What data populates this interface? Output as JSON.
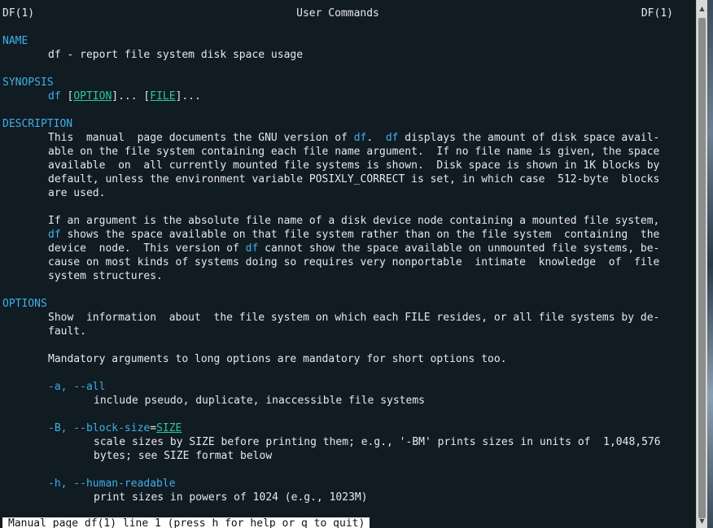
{
  "header": {
    "left": "DF(1)",
    "center": "User Commands",
    "right": "DF(1)"
  },
  "sections": {
    "name": "NAME",
    "synopsis": "SYNOPSIS",
    "description": "DESCRIPTION",
    "options": "OPTIONS"
  },
  "name_line": "df - report file system disk space usage",
  "synopsis": {
    "cmd": "df",
    "open1": " [",
    "arg1": "OPTION",
    "close1": "]... [",
    "arg2": "FILE",
    "close2": "]..."
  },
  "description": {
    "p1": {
      "l1a": "This  manual  page documents the GNU version of ",
      "l1b": "df",
      "l1c": ".  ",
      "l1d": "df",
      "l1e": " displays the amount of disk space avail-",
      "l2": "able on the file system containing each file name argument.  If no file name is given, the space",
      "l3": "available  on  all currently mounted file systems is shown.  Disk space is shown in 1K blocks by",
      "l4": "default, unless the environment variable POSIXLY_CORRECT is set, in which case  512-byte  blocks",
      "l5": "are used."
    },
    "p2": {
      "l1": "If an argument is the absolute file name of a disk device node containing a mounted file system,",
      "l2a": "df",
      "l2b": " shows the space available on that file system rather than on the file system  containing  the",
      "l3a": "device  node.  This version of ",
      "l3b": "df",
      "l3c": " cannot show the space available on unmounted file systems, be-",
      "l4": "cause on most kinds of systems doing so requires very nonportable  intimate  knowledge  of  file",
      "l5": "system structures."
    }
  },
  "options": {
    "intro1": "Show  information  about  the file system on which each FILE resides, or all file systems by de-",
    "intro2": "fault.",
    "mandatory": "Mandatory arguments to long options are mandatory for short options too.",
    "all": {
      "flag": "-a, --all",
      "desc": "include pseudo, duplicate, inaccessible file systems"
    },
    "block": {
      "flag": "-B, --block-size",
      "eq": "=",
      "arg": "SIZE",
      "desc1": "scale sizes by SIZE before printing them; e.g., '-BM' prints sizes in units of  1,048,576",
      "desc2": "bytes; see SIZE format below"
    },
    "human": {
      "flag": "-h, --human-readable",
      "desc": "print sizes in powers of 1024 (e.g., 1023M)"
    }
  },
  "status_bar": "Manual page df(1) line 1 (press h for help or q to quit)",
  "icons": {
    "scroll_up": "triangle-up",
    "scroll_down": "triangle-down"
  },
  "colors": {
    "background": "#111b22",
    "text": "#e6e8ea",
    "heading": "#3fb0e8",
    "argument": "#2fc4a4"
  }
}
